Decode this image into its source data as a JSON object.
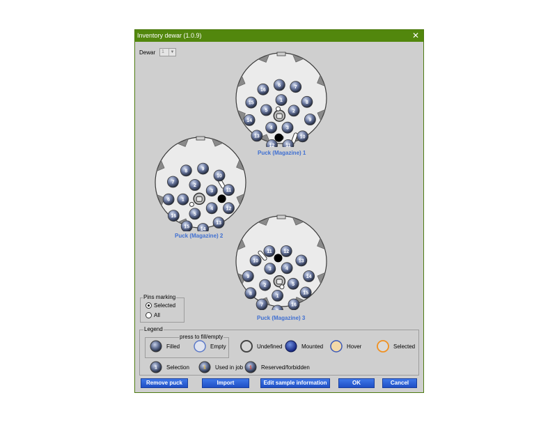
{
  "window": {
    "title": "Inventory dewar (1.0.9)",
    "close_icon": "close-icon"
  },
  "dewar": {
    "label": "Dewar",
    "value": "1"
  },
  "pucks": [
    {
      "id": 1,
      "label": "Puck (Magazine) 1"
    },
    {
      "id": 2,
      "label": "Puck (Magazine) 2"
    },
    {
      "id": 3,
      "label": "Puck (Magazine) 3"
    }
  ],
  "pins_marking": {
    "title": "Pins marking",
    "options": [
      "Selected",
      "All"
    ],
    "selected": "Selected"
  },
  "legend": {
    "title": "Legend",
    "press_group": "press to fill/empty",
    "items": {
      "filled": "Filled",
      "empty": "Empty",
      "undefined": "Undefined",
      "mounted": "Mounted",
      "hover": "Hover",
      "selected": "Selected",
      "selection": "Selection",
      "used_in_job": "Used in job",
      "reserved": "Reserved/forbidden"
    },
    "colors": {
      "mounted": "#1f3fa8",
      "hover": "#f0c070",
      "selected": "#f09020",
      "reserved": "#c84030"
    }
  },
  "buttons": {
    "remove_puck": "Remove puck",
    "import": "Import",
    "edit_sample": "Edit sample information",
    "ok": "OK",
    "cancel": "Cancel"
  }
}
